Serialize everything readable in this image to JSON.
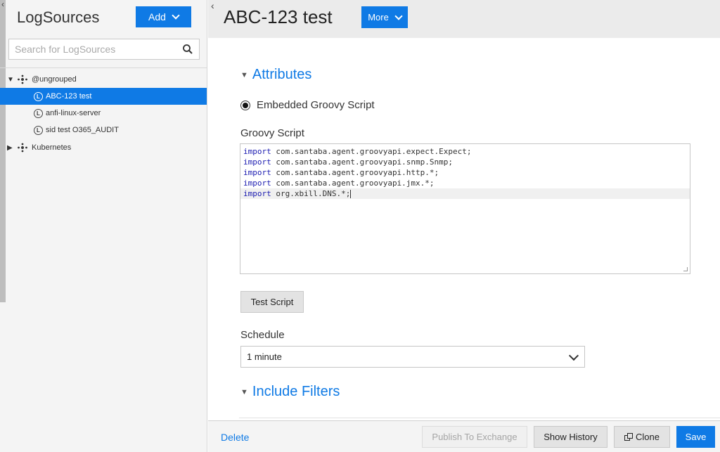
{
  "left_panel": {
    "title": "LogSources",
    "add_label": "Add",
    "search_placeholder": "Search for LogSources",
    "tree": {
      "group1": "@ungrouped",
      "items": [
        "ABC-123 test",
        "anfi-linux-server",
        "sid test O365_AUDIT"
      ],
      "group2": "Kubernetes"
    }
  },
  "header": {
    "title": "ABC-123 test",
    "more_label": "More"
  },
  "attributes": {
    "section_title": "Attributes",
    "radio_label": "Embedded Groovy Script",
    "script_label": "Groovy Script",
    "script_keyword": "import",
    "script_lines": [
      "com.santaba.agent.groovyapi.expect.Expect;",
      "com.santaba.agent.groovyapi.snmp.Snmp;",
      "com.santaba.agent.groovyapi.http.*;",
      "com.santaba.agent.groovyapi.jmx.*;",
      "org.xbill.DNS.*;"
    ],
    "test_button": "Test Script",
    "schedule_label": "Schedule",
    "schedule_value": "1 minute"
  },
  "include_filters": {
    "section_title": "Include Filters"
  },
  "footer": {
    "delete": "Delete",
    "publish": "Publish To Exchange",
    "history": "Show History",
    "clone": "Clone",
    "save": "Save"
  },
  "colors": {
    "accent": "#0f7ae5",
    "selected_row": "#0f7ae5"
  }
}
